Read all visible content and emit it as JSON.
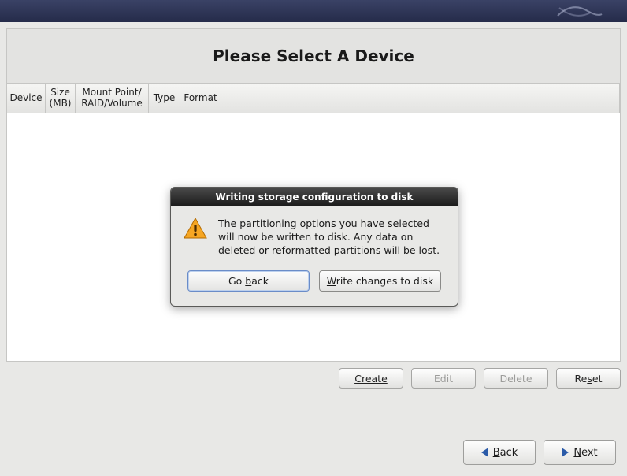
{
  "header": {
    "title": "Please Select A Device"
  },
  "columns": {
    "device": "Device",
    "size_line1": "Size",
    "size_line2": "(MB)",
    "mount_line1": "Mount Point/",
    "mount_line2": "RAID/Volume",
    "type": "Type",
    "format": "Format"
  },
  "toolbar": {
    "create": "Create",
    "edit": "Edit",
    "delete": "Delete",
    "reset": "Reset"
  },
  "nav": {
    "back": "Back",
    "next": "Next"
  },
  "dialog": {
    "title": "Writing storage configuration to disk",
    "message": "The partitioning options you have selected will now be written to disk.  Any data on deleted or reformatted partitions will be lost.",
    "go_back_pre": "Go ",
    "go_back_ul": "b",
    "go_back_post": "ack",
    "write_ul": "W",
    "write_post": "rite changes to disk"
  }
}
